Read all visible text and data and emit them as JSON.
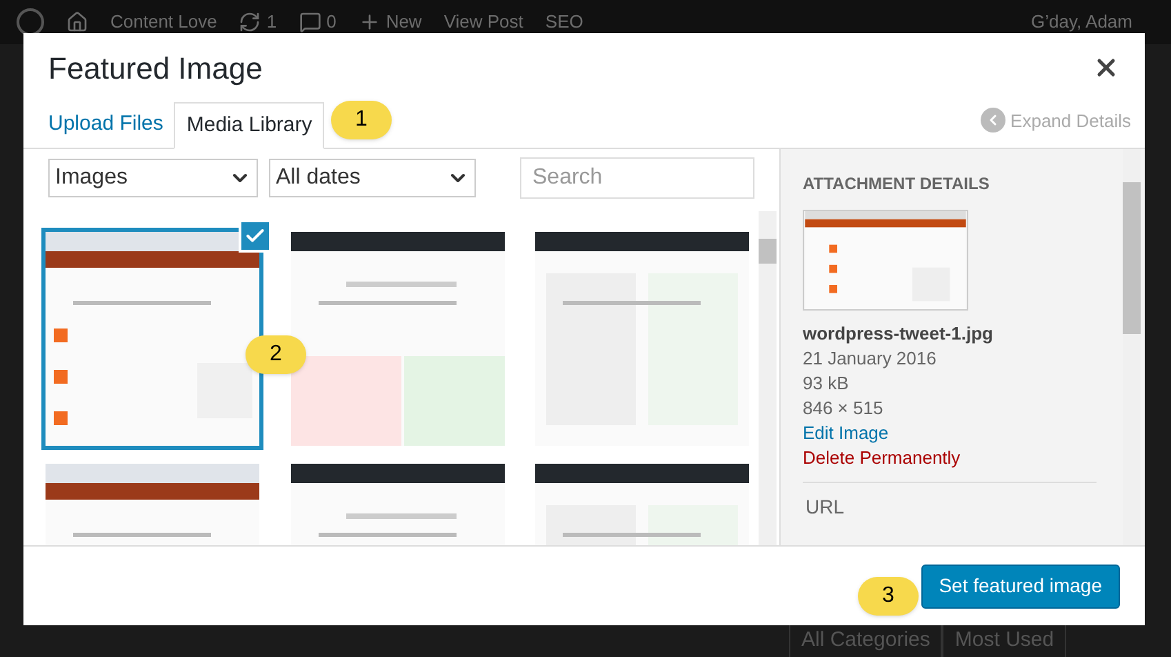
{
  "admin_bar": {
    "site": "Content Love",
    "updates": "1",
    "comments": "0",
    "new": "New",
    "view_post": "View Post",
    "seo": "SEO",
    "greeting": "G’day, Adam"
  },
  "background": {
    "categories_tabs": [
      "All Categories",
      "Most Used"
    ]
  },
  "modal": {
    "title": "Featured Image",
    "tabs": [
      {
        "label": "Upload Files",
        "selected": false
      },
      {
        "label": "Media Library",
        "selected": true
      }
    ],
    "expand_details": "Expand Details",
    "filters": {
      "type": "Images",
      "date": "All dates"
    },
    "search": {
      "placeholder": "Search"
    },
    "attachments": [
      {
        "kind": "picture",
        "selected": true
      },
      {
        "kind": "picture",
        "selected": false
      },
      {
        "kind": "picture",
        "selected": false
      },
      {
        "kind": "picture",
        "selected": false
      },
      {
        "kind": "picture",
        "selected": false
      },
      {
        "kind": "picture",
        "selected": false
      }
    ],
    "details": {
      "heading": "ATTACHMENT DETAILS",
      "filename": "wordpress-tweet-1.jpg",
      "date": "21 January 2016",
      "size": "93 kB",
      "dimensions": "846 × 515",
      "edit_link": "Edit Image",
      "delete_link": "Delete Permanently",
      "url_label": "URL"
    },
    "primary_button": "Set featured image"
  },
  "callouts": [
    "1",
    "2",
    "3"
  ]
}
